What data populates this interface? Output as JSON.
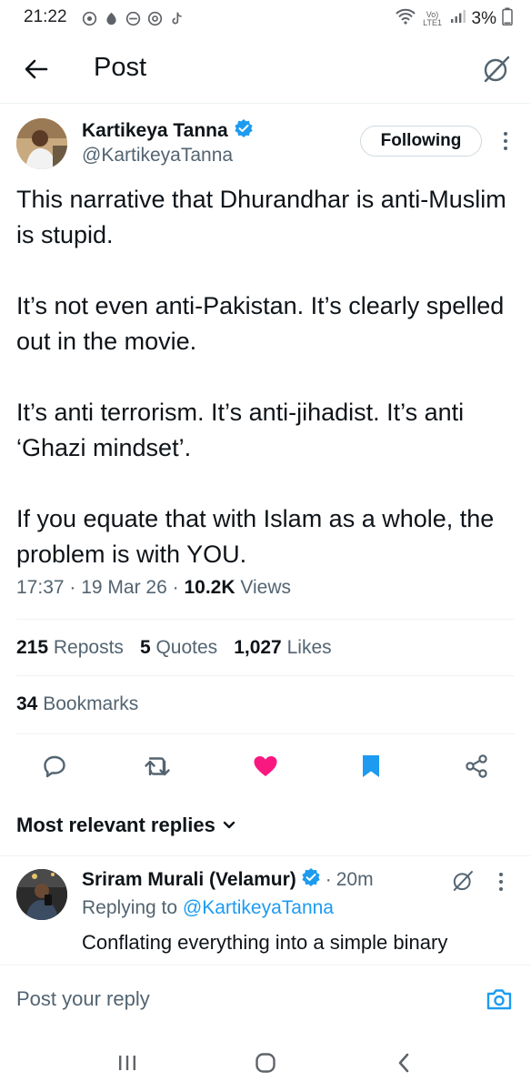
{
  "status_bar": {
    "time": "21:22",
    "network": "Vo) LTE1",
    "battery": "3%"
  },
  "header": {
    "title": "Post"
  },
  "post": {
    "author_name": "Kartikeya Tanna",
    "author_handle": "@KartikeyaTanna",
    "follow_label": "Following",
    "body": [
      "This narrative that Dhurandhar is anti-Muslim is stupid.",
      "It’s not even anti-Pakistan. It’s clearly spelled out in the movie.",
      "It’s anti terrorism. It’s anti-jihadist. It’s anti ‘Ghazi mindset’.",
      "If you equate that with Islam as a whole, the problem is with YOU."
    ],
    "time": "17:37",
    "date": "19 Mar 26",
    "views_count": "10.2K",
    "views_label": "Views",
    "reposts_count": "215",
    "reposts_label": "Reposts",
    "quotes_count": "5",
    "quotes_label": "Quotes",
    "likes_count": "1,027",
    "likes_label": "Likes",
    "bookmarks_count": "34",
    "bookmarks_label": "Bookmarks"
  },
  "replies_section": {
    "sort_label": "Most relevant replies"
  },
  "reply": {
    "author_name": "Sriram Murali (Velamur)",
    "time": "20m",
    "replying_prefix": "Replying to",
    "replying_handle": "@KartikeyaTanna",
    "text": "Conflating everything into a simple binary"
  },
  "composer": {
    "placeholder": "Post your reply"
  },
  "colors": {
    "accent": "#1d9bf0",
    "like": "#f91880",
    "secondary_text": "#536471"
  }
}
